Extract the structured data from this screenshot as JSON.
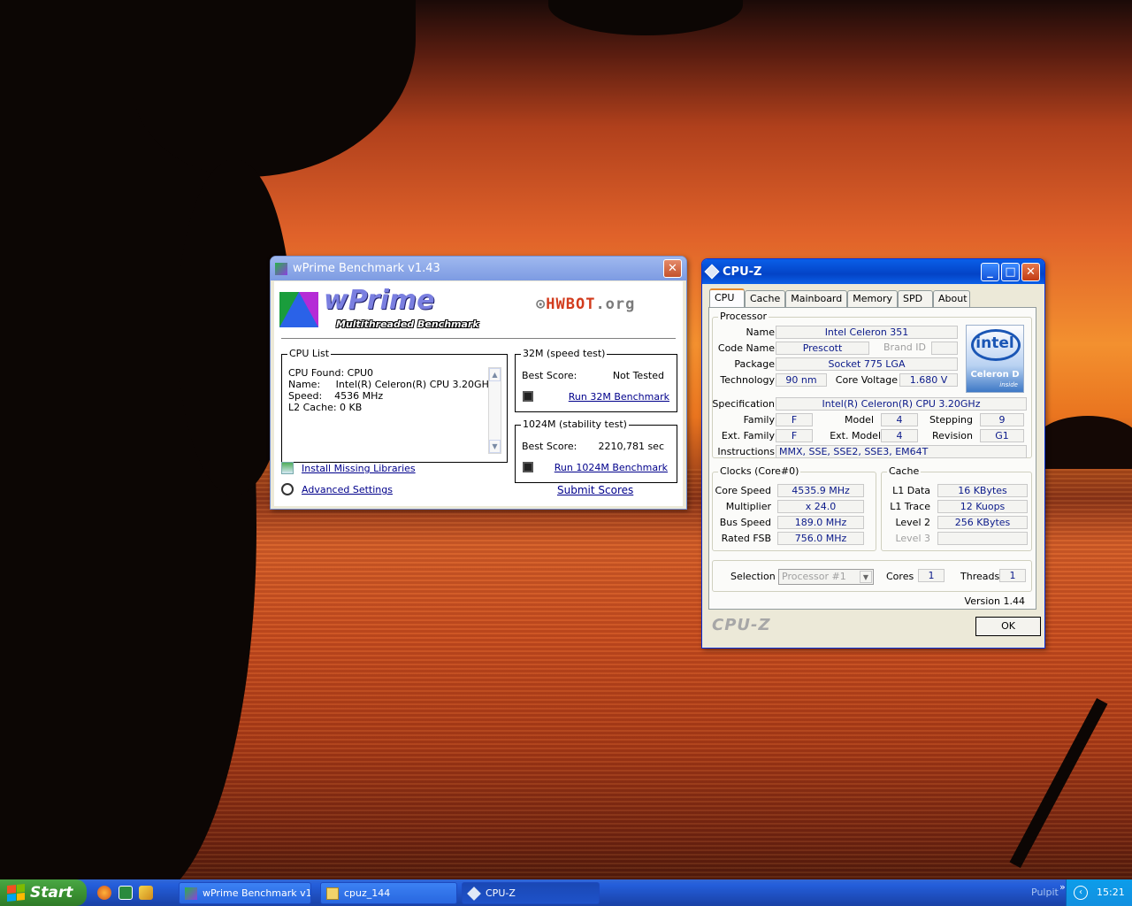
{
  "wprime": {
    "title": "wPrime Benchmark v1.43",
    "logo_title": "wPrime",
    "logo_subtitle": "Multithreaded Benchmark",
    "hwbot_left": "HWBOT",
    "hwbot_right": ".org",
    "cpu_list": {
      "legend": "CPU List",
      "lines": [
        "CPU Found: CPU0",
        "Name:     Intel(R) Celeron(R) CPU 3.20GHz",
        "Speed:    4536 MHz",
        "L2 Cache: 0 KB"
      ]
    },
    "test32": {
      "legend": "32M (speed test)",
      "best_label": "Best Score:",
      "best_value": "Not Tested",
      "run_label": "Run 32M Benchmark"
    },
    "test1024": {
      "legend": "1024M (stability test)",
      "best_label": "Best Score:",
      "best_value": "2210,781 sec",
      "run_label": "Run 1024M Benchmark"
    },
    "install_label": "Install Missing Libraries",
    "advanced_label": "Advanced Settings",
    "submit_label": "Submit Scores"
  },
  "cpuz": {
    "title": "CPU-Z",
    "tabs": [
      "CPU",
      "Cache",
      "Mainboard",
      "Memory",
      "SPD",
      "About"
    ],
    "processor": {
      "legend": "Processor",
      "name_label": "Name",
      "name": "Intel Celeron 351",
      "code_label": "Code Name",
      "code": "Prescott",
      "brand_id": "Brand ID",
      "package_label": "Package",
      "package": "Socket 775 LGA",
      "tech_label": "Technology",
      "tech": "90 nm",
      "voltage_label": "Core Voltage",
      "voltage": "1.680 V",
      "spec_label": "Specification",
      "spec": "Intel(R) Celeron(R) CPU 3.20GHz",
      "family_label": "Family",
      "family": "F",
      "model_label": "Model",
      "model": "4",
      "stepping_label": "Stepping",
      "stepping": "9",
      "extfam_label": "Ext. Family",
      "extfam": "F",
      "extmodel_label": "Ext. Model",
      "extmodel": "4",
      "revision_label": "Revision",
      "revision": "G1",
      "instr_label": "Instructions",
      "instr": "MMX, SSE, SSE2, SSE3, EM64T"
    },
    "intel_logo": {
      "brand": "intel",
      "product": "Celeron D",
      "tag": "inside"
    },
    "clocks": {
      "legend": "Clocks (Core#0)",
      "core_label": "Core Speed",
      "core": "4535.9 MHz",
      "mult_label": "Multiplier",
      "mult": "x 24.0",
      "bus_label": "Bus Speed",
      "bus": "189.0 MHz",
      "fsb_label": "Rated FSB",
      "fsb": "756.0 MHz"
    },
    "cache": {
      "legend": "Cache",
      "l1d_label": "L1 Data",
      "l1d": "16 KBytes",
      "l1t_label": "L1 Trace",
      "l1t": "12 Kuops",
      "l2_label": "Level 2",
      "l2": "256 KBytes",
      "l3_label": "Level 3",
      "l3": ""
    },
    "selection_label": "Selection",
    "selection": "Processor #1",
    "cores_label": "Cores",
    "cores": "1",
    "threads_label": "Threads",
    "threads": "1",
    "version": "Version 1.44",
    "brand": "CPU-Z",
    "ok_label": "OK"
  },
  "taskbar": {
    "start_label": "Start",
    "tasks": [
      "wPrime Benchmark v1...",
      "cpuz_144",
      "CPU-Z"
    ],
    "tray_text": "Pulpit",
    "tray_arrow": "»",
    "clock": "15:21"
  },
  "colors": {
    "xp_blue": "#0a5fe8",
    "start_green": "#3b9232",
    "link": "#00008b",
    "cpuz_value": "#0b1a8a"
  }
}
